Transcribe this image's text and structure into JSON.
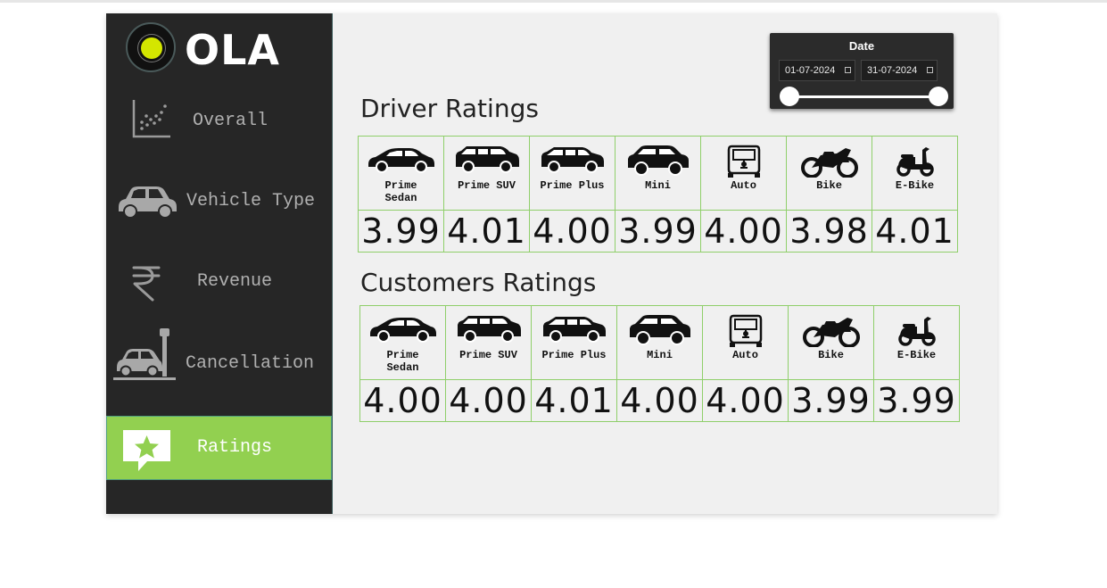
{
  "brand": {
    "name": "OLA"
  },
  "nav": [
    {
      "label": "Overall",
      "icon": "scatter-chart-icon"
    },
    {
      "label": "Vehicle Type",
      "icon": "car-icon"
    },
    {
      "label": "Revenue",
      "icon": "rupee-icon"
    },
    {
      "label": "Cancellation",
      "icon": "car-crash-icon"
    },
    {
      "label": "Ratings",
      "icon": "star-chat-icon",
      "active": true
    }
  ],
  "date_filter": {
    "title": "Date",
    "start": "01-07-2024",
    "end": "31-07-2024"
  },
  "driver_ratings": {
    "title": "Driver Ratings",
    "vehicles": [
      "Prime Sedan",
      "Prime SUV",
      "Prime Plus",
      "Mini",
      "Auto",
      "Bike",
      "E-Bike"
    ],
    "values": [
      "3.99",
      "4.01",
      "4.00",
      "3.99",
      "4.00",
      "3.98",
      "4.01"
    ]
  },
  "customer_ratings": {
    "title": "Customers  Ratings",
    "vehicles": [
      "Prime Sedan",
      "Prime SUV",
      "Prime Plus",
      "Mini",
      "Auto",
      "Bike",
      "E-Bike"
    ],
    "values": [
      "4.00",
      "4.00",
      "4.01",
      "4.00",
      "4.00",
      "3.99",
      "3.99"
    ]
  },
  "colors": {
    "sidebar": "#262626",
    "active": "#92d050",
    "grid": "#8fcf6a",
    "panel": "#f0f0f0"
  }
}
